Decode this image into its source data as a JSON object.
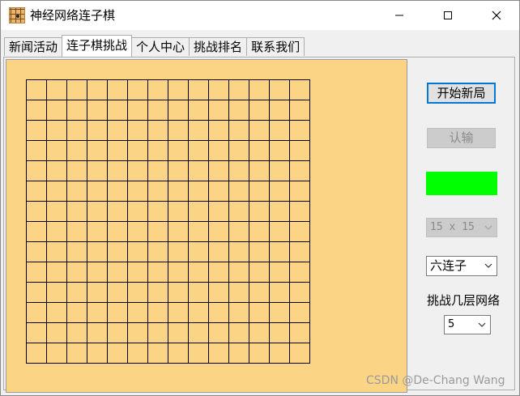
{
  "window": {
    "title": "神经网络连子棋",
    "icon": "go-board-icon",
    "controls": [
      "minimize-icon",
      "maximize-icon",
      "close-icon"
    ]
  },
  "tabs": [
    {
      "label": "新闻活动",
      "active": false
    },
    {
      "label": "连子棋挑战",
      "active": true
    },
    {
      "label": "个人中心",
      "active": false
    },
    {
      "label": "挑战排名",
      "active": false
    },
    {
      "label": "联系我们",
      "active": false
    }
  ],
  "board": {
    "background": "#fcd485",
    "line_color": "#000000",
    "rows": 14,
    "cols": 14
  },
  "controls": {
    "new_game_label": "开始新局",
    "resign_label": "认输",
    "status_color": "#00ff00",
    "board_size": {
      "value": "15 x 15",
      "enabled": false
    },
    "connect_n": {
      "value": "六连子",
      "enabled": true
    },
    "layers_label": "挑战几层网络",
    "layers": {
      "value": "5",
      "enabled": true
    }
  },
  "watermark": "CSDN @De-Chang Wang"
}
